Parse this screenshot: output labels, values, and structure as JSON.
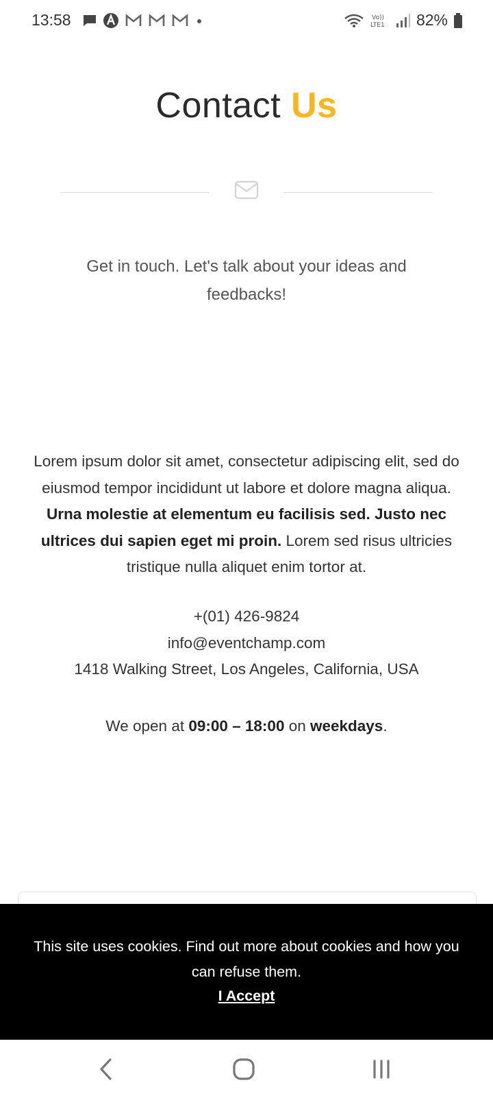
{
  "status_bar": {
    "time": "13:58",
    "battery": "82%",
    "network_label": "Vo)) LTE1"
  },
  "page": {
    "title_main": "Contact ",
    "title_accent": "Us",
    "accent_color": "#f7b71e",
    "divider_icon": "mail-icon",
    "subtitle": "Get in touch. Let's talk about your ideas and feedbacks!",
    "body": {
      "intro": "Lorem ipsum dolor sit amet, consectetur adipiscing elit, sed do eiusmod tempor incididunt ut labore et dolore magna aliqua. ",
      "bold": "Urna molestie at elementum eu facilisis sed. Justo nec ultrices dui sapien eget mi proin.",
      "outro": " Lorem sed risus ultricies tristique nulla aliquet enim tortor at."
    },
    "contact": {
      "phone": "+(01) 426-9824",
      "email": "info@eventchamp.com",
      "address": "1418 Walking Street, Los Angeles, California, USA"
    },
    "hours": {
      "prefix": "We open at ",
      "time_range": "09:00 – 18:00",
      "middle": " on ",
      "days": "weekdays",
      "suffix": "."
    }
  },
  "cookie_banner": {
    "message": "This site uses cookies. Find out more about cookies and how you can refuse them.",
    "accept_label": "I Accept"
  },
  "nav_bar": {
    "back_icon": "back-icon",
    "home_icon": "home-icon",
    "recents_icon": "recents-icon"
  }
}
